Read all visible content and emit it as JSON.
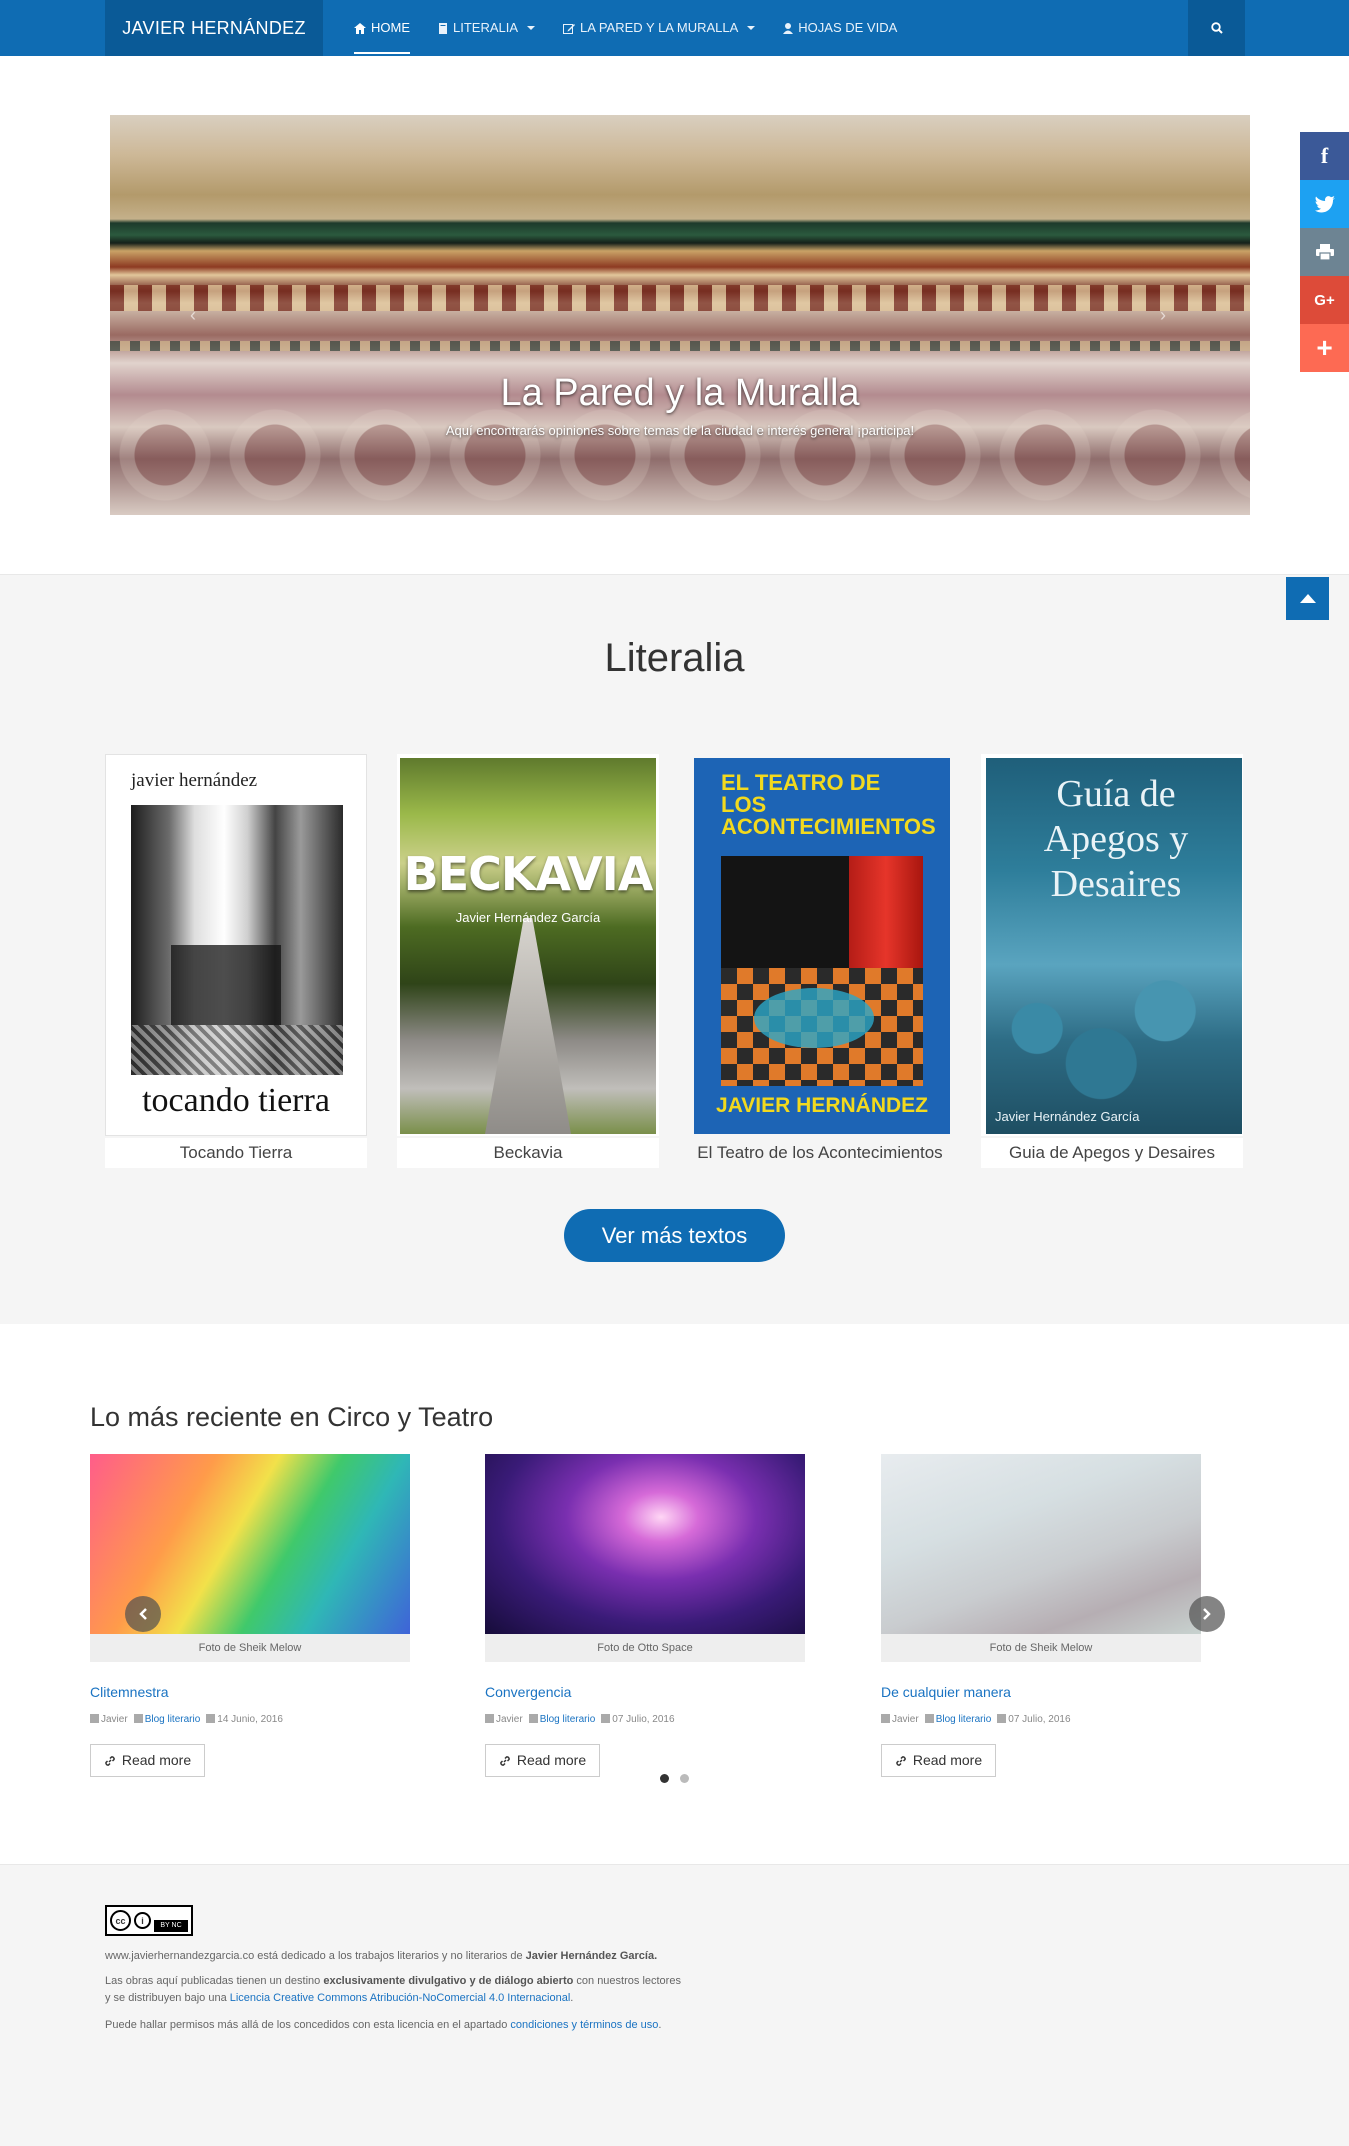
{
  "navbar": {
    "brand": "JAVIER HERNÁNDEZ",
    "items": [
      {
        "label": "HOME",
        "icon": "home-icon",
        "active": true,
        "dropdown": false
      },
      {
        "label": "LITERALIA",
        "icon": "book-icon",
        "active": false,
        "dropdown": true
      },
      {
        "label": "LA PARED Y LA MURALLA",
        "icon": "edit-icon",
        "active": false,
        "dropdown": true
      },
      {
        "label": "HOJAS DE VIDA",
        "icon": "user-icon",
        "active": false,
        "dropdown": false
      }
    ],
    "search_icon": "search-icon"
  },
  "hero": {
    "title": "La Pared y la Muralla",
    "subtitle": "Aquí encontrarás opiniones sobre temas de la ciudad e interés general ¡participa!",
    "prev": "‹",
    "next": "›"
  },
  "share": [
    {
      "name": "facebook",
      "icon": "f",
      "color": "#3b5998"
    },
    {
      "name": "twitter",
      "icon": "🐦",
      "color": "#1da1f2"
    },
    {
      "name": "print",
      "icon": "⎙",
      "color": "#6d8493"
    },
    {
      "name": "google-plus",
      "icon": "G+",
      "color": "#dd4b39"
    },
    {
      "name": "more",
      "icon": "+",
      "color": "#fd6a53"
    }
  ],
  "literalia": {
    "title": "Literalia",
    "books": [
      {
        "label": "Tocando Tierra",
        "cover_author": "javier hernández",
        "cover_title": "tocando tierra"
      },
      {
        "label": "Beckavia",
        "cover_title": "BECKAVIA",
        "cover_author": "Javier Hernández García"
      },
      {
        "label": "El Teatro de los Acontecimientos",
        "cover_title": "EL TEATRO DE LOS ACONTECIMIENTOS",
        "cover_author": "JAVIER HERNÁNDEZ"
      },
      {
        "label": "Guia de Apegos y Desaires",
        "cover_title": "Guía de Apegos y Desaires",
        "cover_author": "Javier Hernández García"
      }
    ],
    "cta": "Ver más textos"
  },
  "recent": {
    "title": "Lo más reciente en Circo y Teatro",
    "posts": [
      {
        "credit": "Foto de Sheik Melow",
        "title": "Clitemnestra",
        "author": "Javier",
        "category": "Blog literario",
        "date": "14 Junio, 2016",
        "readmore": "Read more"
      },
      {
        "credit": "Foto de Otto Space",
        "title": "Convergencia",
        "author": "Javier",
        "category": "Blog literario",
        "date": "07 Julio, 2016",
        "readmore": "Read more"
      },
      {
        "credit": "Foto de Sheik Melow",
        "title": "De cualquier manera",
        "author": "Javier",
        "category": "Blog literario",
        "date": "07 Julio, 2016",
        "readmore": "Read more"
      }
    ]
  },
  "footer": {
    "cc_strip": "BY   NC",
    "line1_pre": "www.javierhernandezgarcia.co está dedicado a los trabajos literarios y no literarios de ",
    "line1_bold": "Javier Hernández García.",
    "line2_pre": "Las obras aquí publicadas tienen un destino ",
    "line2_bold": "exclusivamente divulgativo y de diálogo abierto",
    "line2_post": " con nuestros lectores",
    "line3_pre": "y se distribuyen bajo una ",
    "line3_link": "Licencia Creative Commons Atribución-NoComercial 4.0 Internacional",
    "line3_post": ".",
    "line4_pre": "Puede hallar permisos más allá de los concedidos con esta licencia en el apartado ",
    "line4_link": "condiciones y términos de uso",
    "line4_post": "."
  }
}
